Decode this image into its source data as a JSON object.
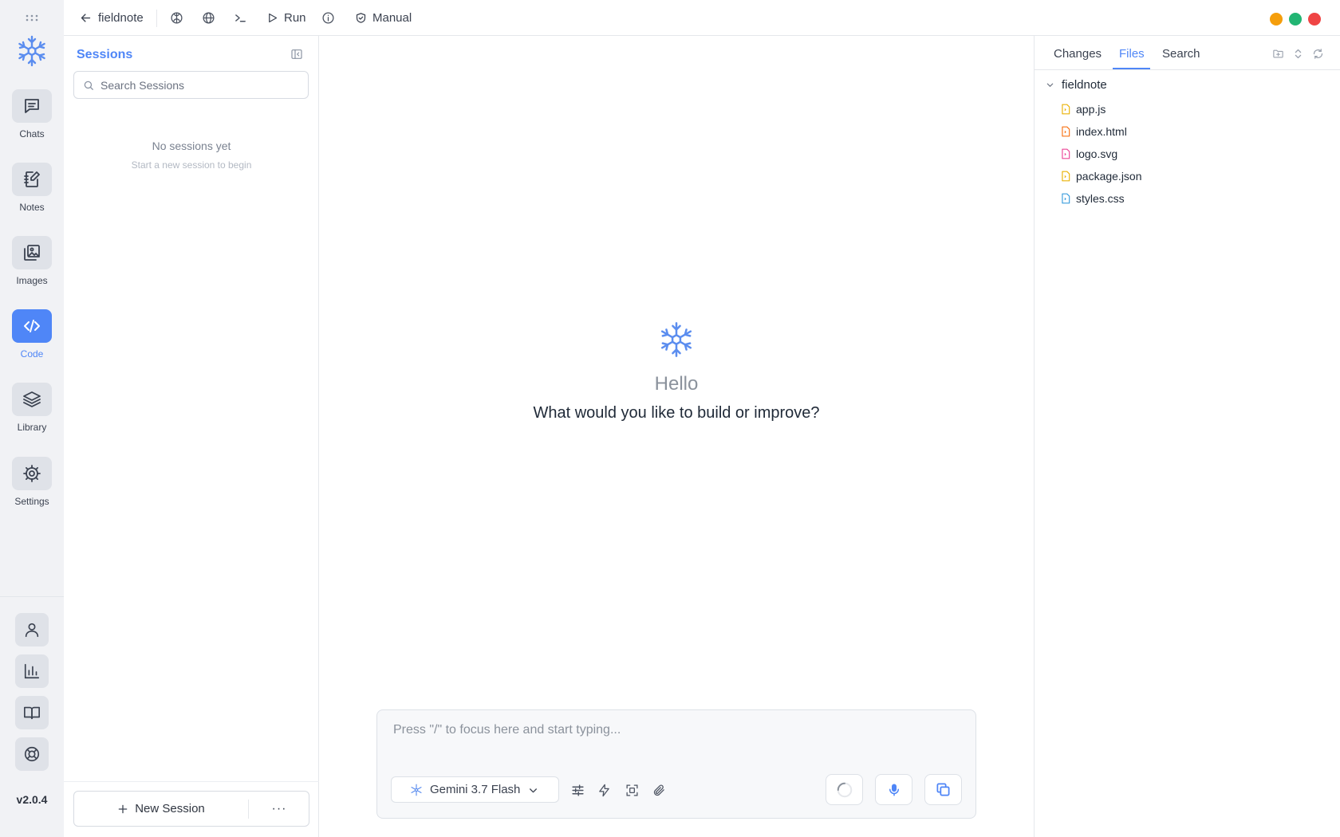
{
  "app": {
    "version": "v2.0.4",
    "accent_color": "#4f86f7",
    "logo_icon": "snowflake-logo-icon"
  },
  "sidebar": {
    "items": [
      {
        "label": "Chats",
        "icon": "chat-icon",
        "active": false
      },
      {
        "label": "Notes",
        "icon": "notebook-edit-icon",
        "active": false
      },
      {
        "label": "Images",
        "icon": "images-icon",
        "active": false
      },
      {
        "label": "Code",
        "icon": "code-icon",
        "active": true
      },
      {
        "label": "Library",
        "icon": "layers-icon",
        "active": false
      },
      {
        "label": "Settings",
        "icon": "gear-icon",
        "active": false
      }
    ],
    "bottom_icons": [
      "user-icon",
      "bar-chart-icon",
      "book-icon",
      "lifebuoy-icon"
    ]
  },
  "topbar": {
    "back_label": "fieldnote",
    "run_label": "Run",
    "mode_label": "Manual",
    "window_controls": {
      "minimize": "#f59e0b",
      "maximize": "#22b573",
      "close": "#ef4444"
    }
  },
  "sessions": {
    "title": "Sessions",
    "search_placeholder": "Search Sessions",
    "empty_title": "No sessions yet",
    "empty_subtitle": "Start a new session to begin",
    "new_session_label": "New Session",
    "more_label": "···"
  },
  "main": {
    "greeting": "Hello",
    "question": "What would you like to build or improve?",
    "composer_placeholder": "Press \"/\" to focus here and start typing...",
    "model_label": "Gemini 3.7 Flash"
  },
  "files_panel": {
    "tabs": [
      {
        "label": "Changes",
        "active": false
      },
      {
        "label": "Files",
        "active": true
      },
      {
        "label": "Search",
        "active": false
      }
    ],
    "root_folder": "fieldnote",
    "files": [
      {
        "name": "app.js",
        "color": "#eab308"
      },
      {
        "name": "index.html",
        "color": "#f97316"
      },
      {
        "name": "logo.svg",
        "color": "#ec4899"
      },
      {
        "name": "package.json",
        "color": "#eab308"
      },
      {
        "name": "styles.css",
        "color": "#3b9ddd"
      }
    ]
  }
}
